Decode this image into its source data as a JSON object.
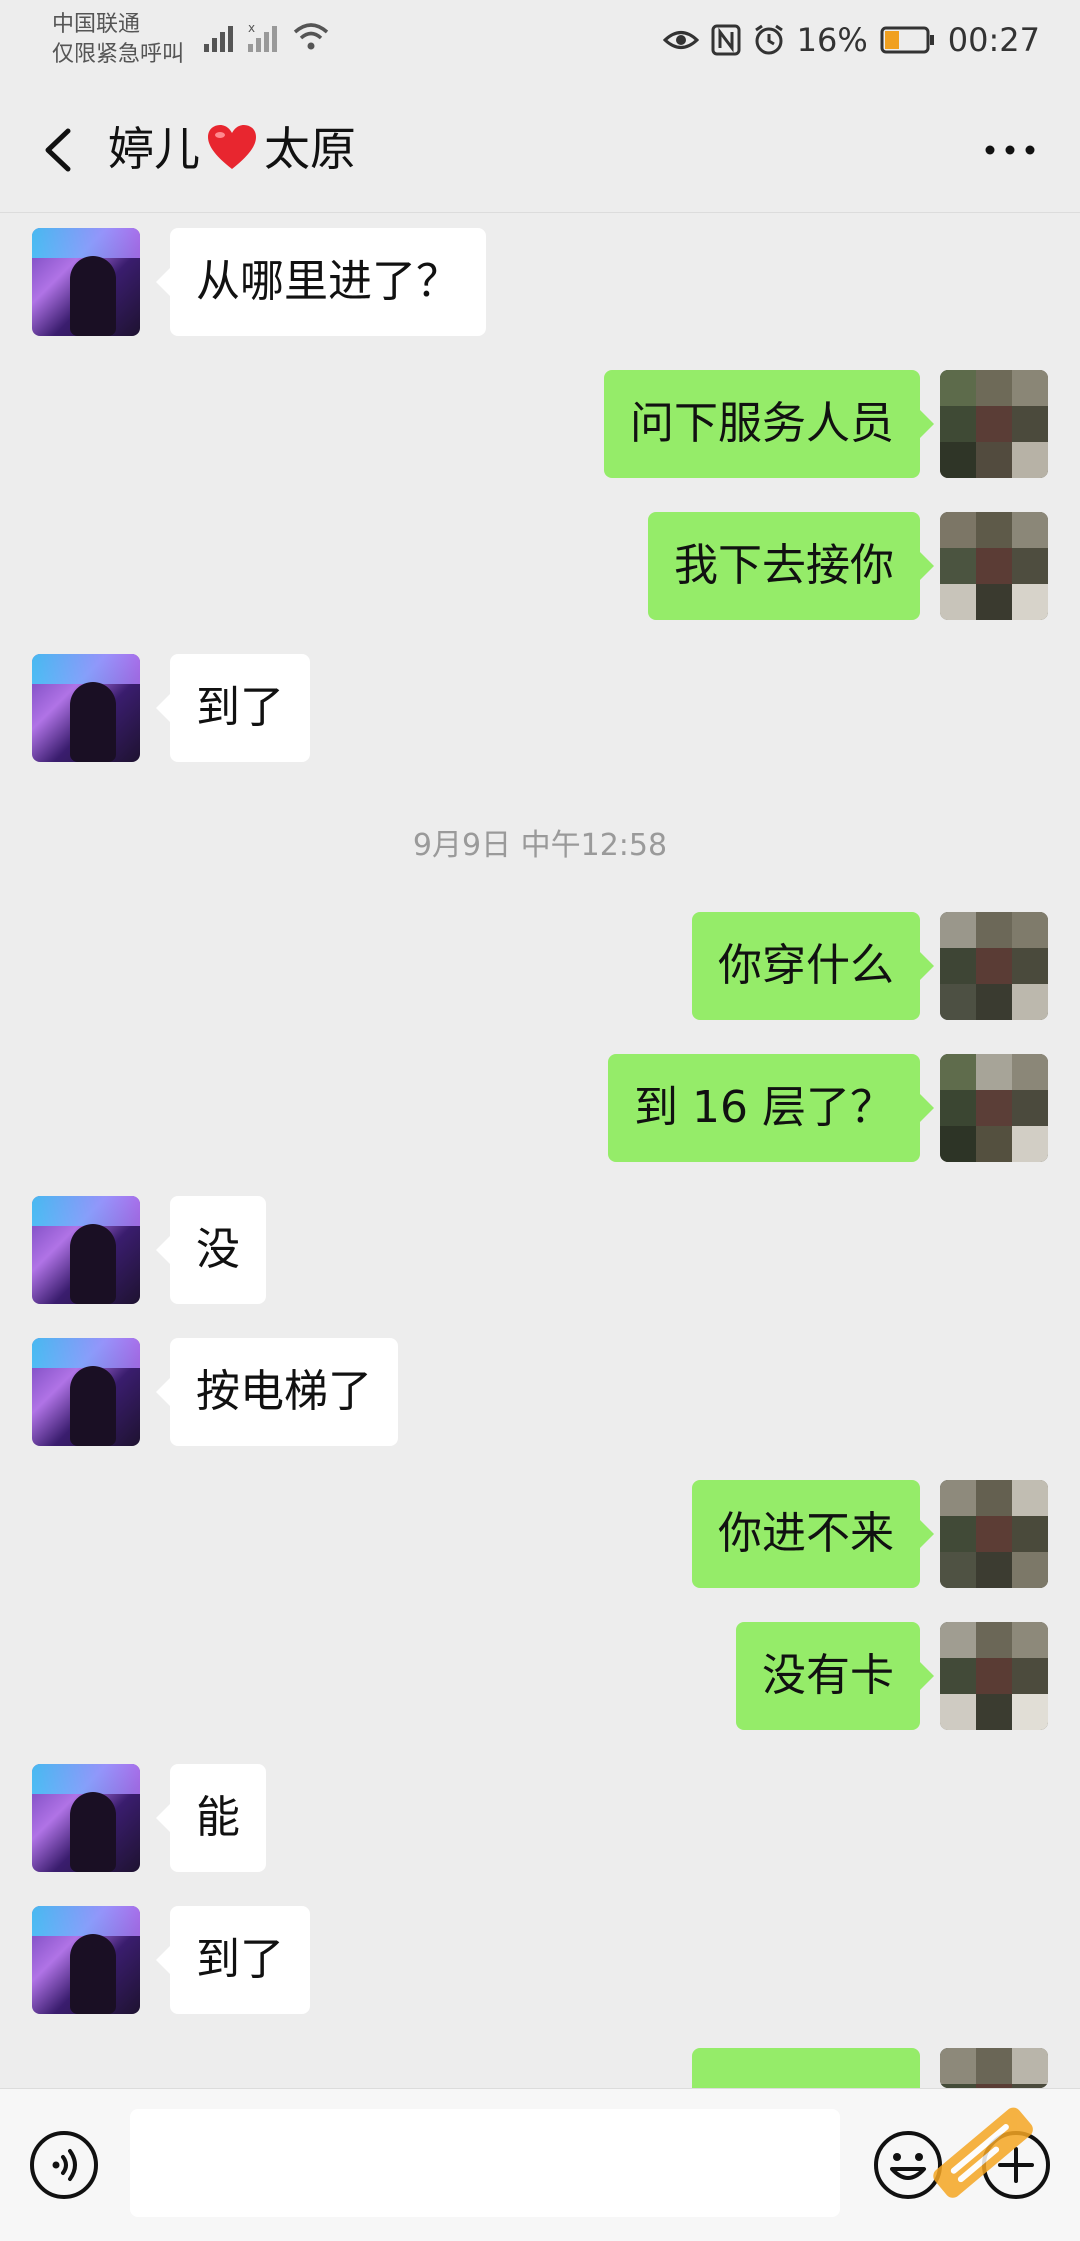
{
  "status_bar": {
    "carrier_line1": "中国联通",
    "carrier_line2": "仅限紧急呼叫",
    "battery": "16%",
    "time": "00:27"
  },
  "header": {
    "title_name": "婷儿",
    "title_suffix": "太原",
    "heart_icon": "red-heart-icon",
    "back_icon": "chevron-left-icon",
    "more_icon": "more-dots-icon"
  },
  "timestamp": "9月9日 中午12:58",
  "messages": [
    {
      "side": "recv",
      "text": "从哪里进了？"
    },
    {
      "side": "sent",
      "text": "问下服务人员"
    },
    {
      "side": "sent",
      "text": "我下去接你"
    },
    {
      "side": "recv",
      "text": "到了"
    },
    {
      "side": "sent",
      "text": "你穿什么"
    },
    {
      "side": "sent",
      "text": "到 16 层了？"
    },
    {
      "side": "recv",
      "text": "没"
    },
    {
      "side": "recv",
      "text": "按电梯了"
    },
    {
      "side": "sent",
      "text": "你进不来"
    },
    {
      "side": "sent",
      "text": "没有卡"
    },
    {
      "side": "recv",
      "text": "能"
    },
    {
      "side": "recv",
      "text": "到了"
    }
  ],
  "input_bar": {
    "voice_icon": "voice-icon",
    "emoji_icon": "emoji-icon",
    "plus_icon": "plus-icon",
    "text": ""
  },
  "colors": {
    "background": "#ededed",
    "sent_bubble": "#95ec69",
    "recv_bubble": "#ffffff"
  }
}
